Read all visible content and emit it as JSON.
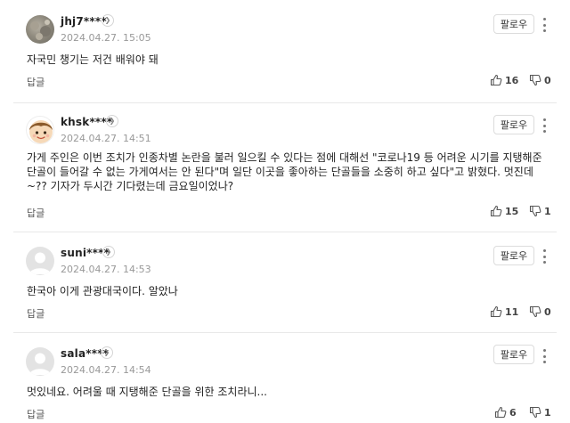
{
  "comments": [
    {
      "username": "jhj7****",
      "date": "2024.04.27. 15:05",
      "text": "자국민 챙기는 저건 배워야 돼",
      "reply_label": "답글",
      "likes": "16",
      "dislikes": "0",
      "follow_label": "팔로우",
      "avatar": "photo-avatar"
    },
    {
      "username": "khsk****",
      "date": "2024.04.27. 14:51",
      "text_lines": [
        "가게 주인은 이번 조치가 인종차별 논란을 불러 일으킬 수 있다는 점에 대해선 \"코로나19 등 어려운 시기를 지탱해준",
        "단골이 들어갈 수 없는 가게여서는 안 된다\"며 일단 이곳을 좋아하는 단골들을 소중히 하고 싶다\"고 밝혔다. 멋진데",
        "~?? 기자가 두시간 기다렸는데 금요일이었나?"
      ],
      "reply_label": "답글",
      "likes": "15",
      "dislikes": "1",
      "follow_label": "팔로우",
      "avatar": "cartoon-face-avatar"
    },
    {
      "username": "suni****",
      "date": "2024.04.27. 14:53",
      "text": "한국아 이게 관광대국이다. 알았나",
      "reply_label": "답글",
      "likes": "11",
      "dislikes": "0",
      "follow_label": "팔로우",
      "avatar": "default-avatar"
    },
    {
      "username": "sala****",
      "date": "2024.04.27. 14:54",
      "text": "멋있네요. 어려울 때 지탱해준 단골을 위한 조치라니...",
      "reply_label": "답글",
      "likes": "6",
      "dislikes": "1",
      "follow_label": "팔로우",
      "avatar": "default-avatar"
    }
  ],
  "icons": {
    "profile_chevron": "chevron-right-icon",
    "like": "thumbs-up-icon",
    "dislike": "thumbs-down-icon",
    "more": "more-vertical-icon"
  },
  "colors": {
    "text": "#222222",
    "meta": "#999999",
    "divider": "#e8e8e8",
    "button_border": "#dcdcdc"
  }
}
